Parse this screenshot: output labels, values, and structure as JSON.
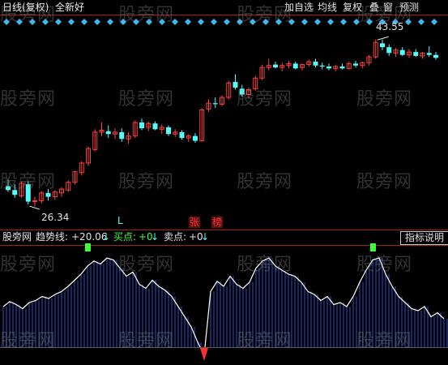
{
  "topbar": {
    "title": "日线(复权)",
    "stock_name": "全新好",
    "buttons": [
      "加自选",
      "均线",
      "复权",
      "叠",
      "窗",
      "预测"
    ]
  },
  "main_chart": {
    "price_high_label": "43.55",
    "price_low_label": "26.34",
    "markers": {
      "l": "L",
      "zhang": "张",
      "bang": "榜"
    }
  },
  "indicator": {
    "name": "股旁网",
    "trend_label": "趋势线:",
    "trend_value": "+20.06",
    "buy_label": "买点:",
    "buy_value": "+0",
    "sell_label": "卖点:",
    "sell_value": "+0",
    "help_label": "指标说明"
  },
  "watermark": "股旁网",
  "colors": {
    "up": "#ff4040",
    "down": "#54fcfc",
    "diamond": "#3fb8f0",
    "indicator_bar": "#3050c8",
    "buy": "#3cff3c",
    "sell": "#ff3030"
  },
  "chart_data": {
    "type": "candlestick",
    "candles": [
      [
        28.4,
        29.1,
        27.8,
        28.0
      ],
      [
        28.0,
        28.6,
        27.2,
        27.5
      ],
      [
        27.4,
        28.9,
        27.2,
        28.7
      ],
      [
        28.6,
        28.9,
        26.5,
        26.8
      ],
      [
        26.8,
        27.3,
        26.3,
        26.9
      ],
      [
        26.9,
        27.9,
        26.6,
        27.7
      ],
      [
        27.7,
        28.1,
        26.9,
        27.3
      ],
      [
        27.3,
        28.0,
        27.0,
        27.8
      ],
      [
        27.7,
        28.3,
        27.3,
        28.1
      ],
      [
        28.0,
        29.0,
        27.8,
        28.8
      ],
      [
        28.8,
        30.0,
        28.6,
        29.9
      ],
      [
        29.8,
        31.0,
        29.5,
        30.8
      ],
      [
        30.8,
        32.5,
        30.5,
        32.3
      ],
      [
        32.2,
        34.3,
        32.0,
        34.0
      ],
      [
        34.0,
        35.0,
        33.6,
        34.2
      ],
      [
        34.1,
        34.7,
        33.4,
        33.8
      ],
      [
        33.8,
        34.4,
        33.3,
        34.0
      ],
      [
        34.0,
        34.4,
        33.0,
        33.3
      ],
      [
        33.3,
        34.0,
        32.8,
        33.6
      ],
      [
        33.6,
        35.2,
        33.4,
        35.0
      ],
      [
        35.0,
        35.4,
        34.2,
        34.4
      ],
      [
        34.5,
        35.1,
        34.1,
        34.9
      ],
      [
        34.9,
        35.1,
        34.2,
        34.3
      ],
      [
        34.3,
        34.8,
        33.8,
        34.5
      ],
      [
        34.5,
        34.7,
        33.6,
        33.8
      ],
      [
        33.8,
        34.3,
        33.5,
        34.0
      ],
      [
        34.0,
        34.2,
        33.2,
        33.4
      ],
      [
        33.4,
        33.8,
        33.0,
        33.6
      ],
      [
        33.6,
        33.9,
        32.9,
        33.1
      ],
      [
        33.1,
        36.5,
        33.0,
        36.3
      ],
      [
        36.4,
        37.4,
        36.1,
        37.0
      ],
      [
        37.0,
        37.6,
        36.5,
        36.9
      ],
      [
        36.9,
        37.8,
        36.7,
        37.6
      ],
      [
        37.6,
        39.3,
        37.4,
        39.1
      ],
      [
        39.2,
        40.0,
        38.4,
        38.6
      ],
      [
        38.5,
        38.9,
        37.7,
        37.9
      ],
      [
        37.9,
        38.6,
        37.5,
        38.4
      ],
      [
        38.5,
        39.8,
        38.3,
        39.6
      ],
      [
        39.6,
        41.0,
        39.4,
        40.7
      ],
      [
        40.7,
        41.6,
        40.4,
        40.9
      ],
      [
        41.0,
        41.3,
        40.6,
        40.7
      ],
      [
        40.7,
        41.2,
        40.3,
        40.9
      ],
      [
        40.9,
        41.4,
        40.6,
        41.1
      ],
      [
        41.1,
        41.3,
        40.5,
        40.6
      ],
      [
        40.7,
        41.1,
        40.4,
        41.0
      ],
      [
        41.0,
        41.5,
        40.8,
        41.3
      ],
      [
        41.3,
        41.6,
        40.7,
        40.9
      ],
      [
        40.9,
        41.2,
        40.5,
        40.8
      ],
      [
        40.8,
        41.1,
        40.4,
        40.6
      ],
      [
        40.6,
        41.0,
        40.3,
        40.8
      ],
      [
        40.8,
        41.1,
        40.5,
        40.6
      ],
      [
        40.6,
        41.3,
        40.5,
        41.1
      ],
      [
        41.1,
        41.4,
        40.7,
        40.9
      ],
      [
        40.9,
        41.3,
        40.6,
        41.2
      ],
      [
        41.2,
        42.0,
        40.9,
        41.8
      ],
      [
        41.8,
        43.6,
        41.6,
        43.3
      ],
      [
        43.2,
        43.6,
        42.5,
        42.8
      ],
      [
        42.8,
        43.1,
        41.9,
        42.2
      ],
      [
        42.2,
        42.7,
        41.8,
        42.5
      ],
      [
        42.5,
        42.8,
        41.9,
        42.0
      ],
      [
        42.0,
        42.6,
        41.7,
        42.3
      ],
      [
        42.3,
        42.6,
        41.8,
        41.9
      ],
      [
        41.9,
        42.3,
        41.6,
        42.2
      ],
      [
        42.2,
        42.9,
        41.8,
        42.0
      ],
      [
        42.0,
        42.3,
        41.5,
        41.7
      ]
    ],
    "trend": [
      40,
      45,
      42,
      38,
      44,
      46,
      50,
      48,
      52,
      55,
      60,
      66,
      72,
      80,
      85,
      82,
      88,
      86,
      78,
      70,
      74,
      62,
      58,
      66,
      60,
      56,
      50,
      40,
      30,
      20,
      5,
      -8,
      55,
      65,
      60,
      70,
      62,
      58,
      64,
      78,
      85,
      88,
      80,
      76,
      72,
      70,
      64,
      55,
      52,
      46,
      50,
      42,
      44,
      40,
      50,
      64,
      76,
      86,
      88,
      72,
      60,
      50,
      44,
      38,
      36,
      40,
      30,
      34,
      28
    ],
    "buy": [
      13,
      57
    ],
    "sell": [
      31
    ]
  }
}
